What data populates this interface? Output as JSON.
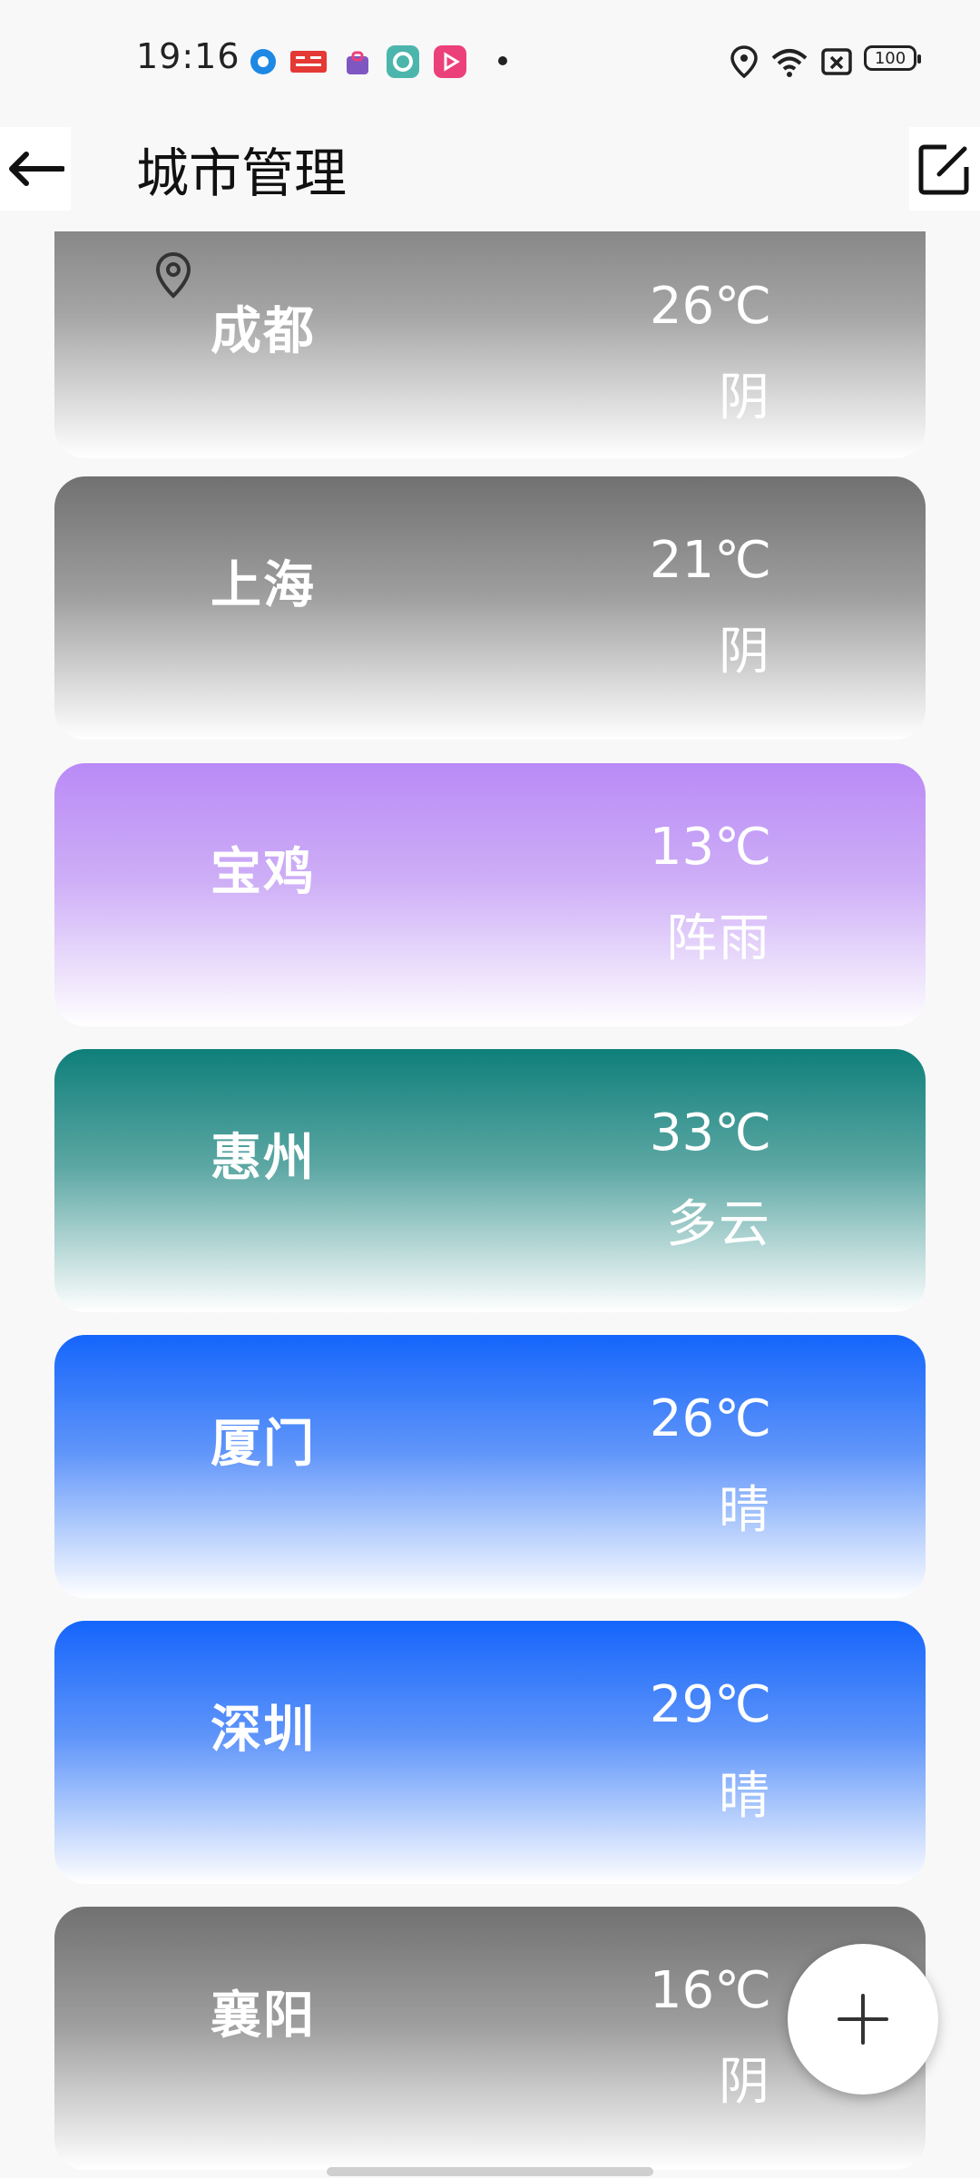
{
  "status_bar": {
    "time": "19:16",
    "battery": "100",
    "icons": [
      "browser-icon",
      "toutiao-icon",
      "shopping-icon",
      "camera-app-icon",
      "video-app-icon",
      "location-icon",
      "wifi-icon",
      "sim-off-icon",
      "battery-icon"
    ]
  },
  "header": {
    "title": "城市管理",
    "back_icon": "arrow-left-icon",
    "edit_icon": "edit-icon"
  },
  "cities": [
    {
      "name": "成都",
      "temp": "26℃",
      "condition": "阴",
      "current_location": true,
      "top_color": "#7b7b7b"
    },
    {
      "name": "上海",
      "temp": "21℃",
      "condition": "阴",
      "current_location": false,
      "top_color": "#717171"
    },
    {
      "name": "宝鸡",
      "temp": "13℃",
      "condition": "阵雨",
      "current_location": false,
      "top_color": "#b98af6"
    },
    {
      "name": "惠州",
      "temp": "33℃",
      "condition": "多云",
      "current_location": false,
      "top_color": "#0f7f7a"
    },
    {
      "name": "厦门",
      "temp": "26℃",
      "condition": "晴",
      "current_location": false,
      "top_color": "#1565fb"
    },
    {
      "name": "深圳",
      "temp": "29℃",
      "condition": "晴",
      "current_location": false,
      "top_color": "#1565fb"
    },
    {
      "name": "襄阳",
      "temp": "16℃",
      "condition": "阴",
      "current_location": false,
      "top_color": "#717171"
    }
  ],
  "fab": {
    "icon": "plus-icon"
  }
}
